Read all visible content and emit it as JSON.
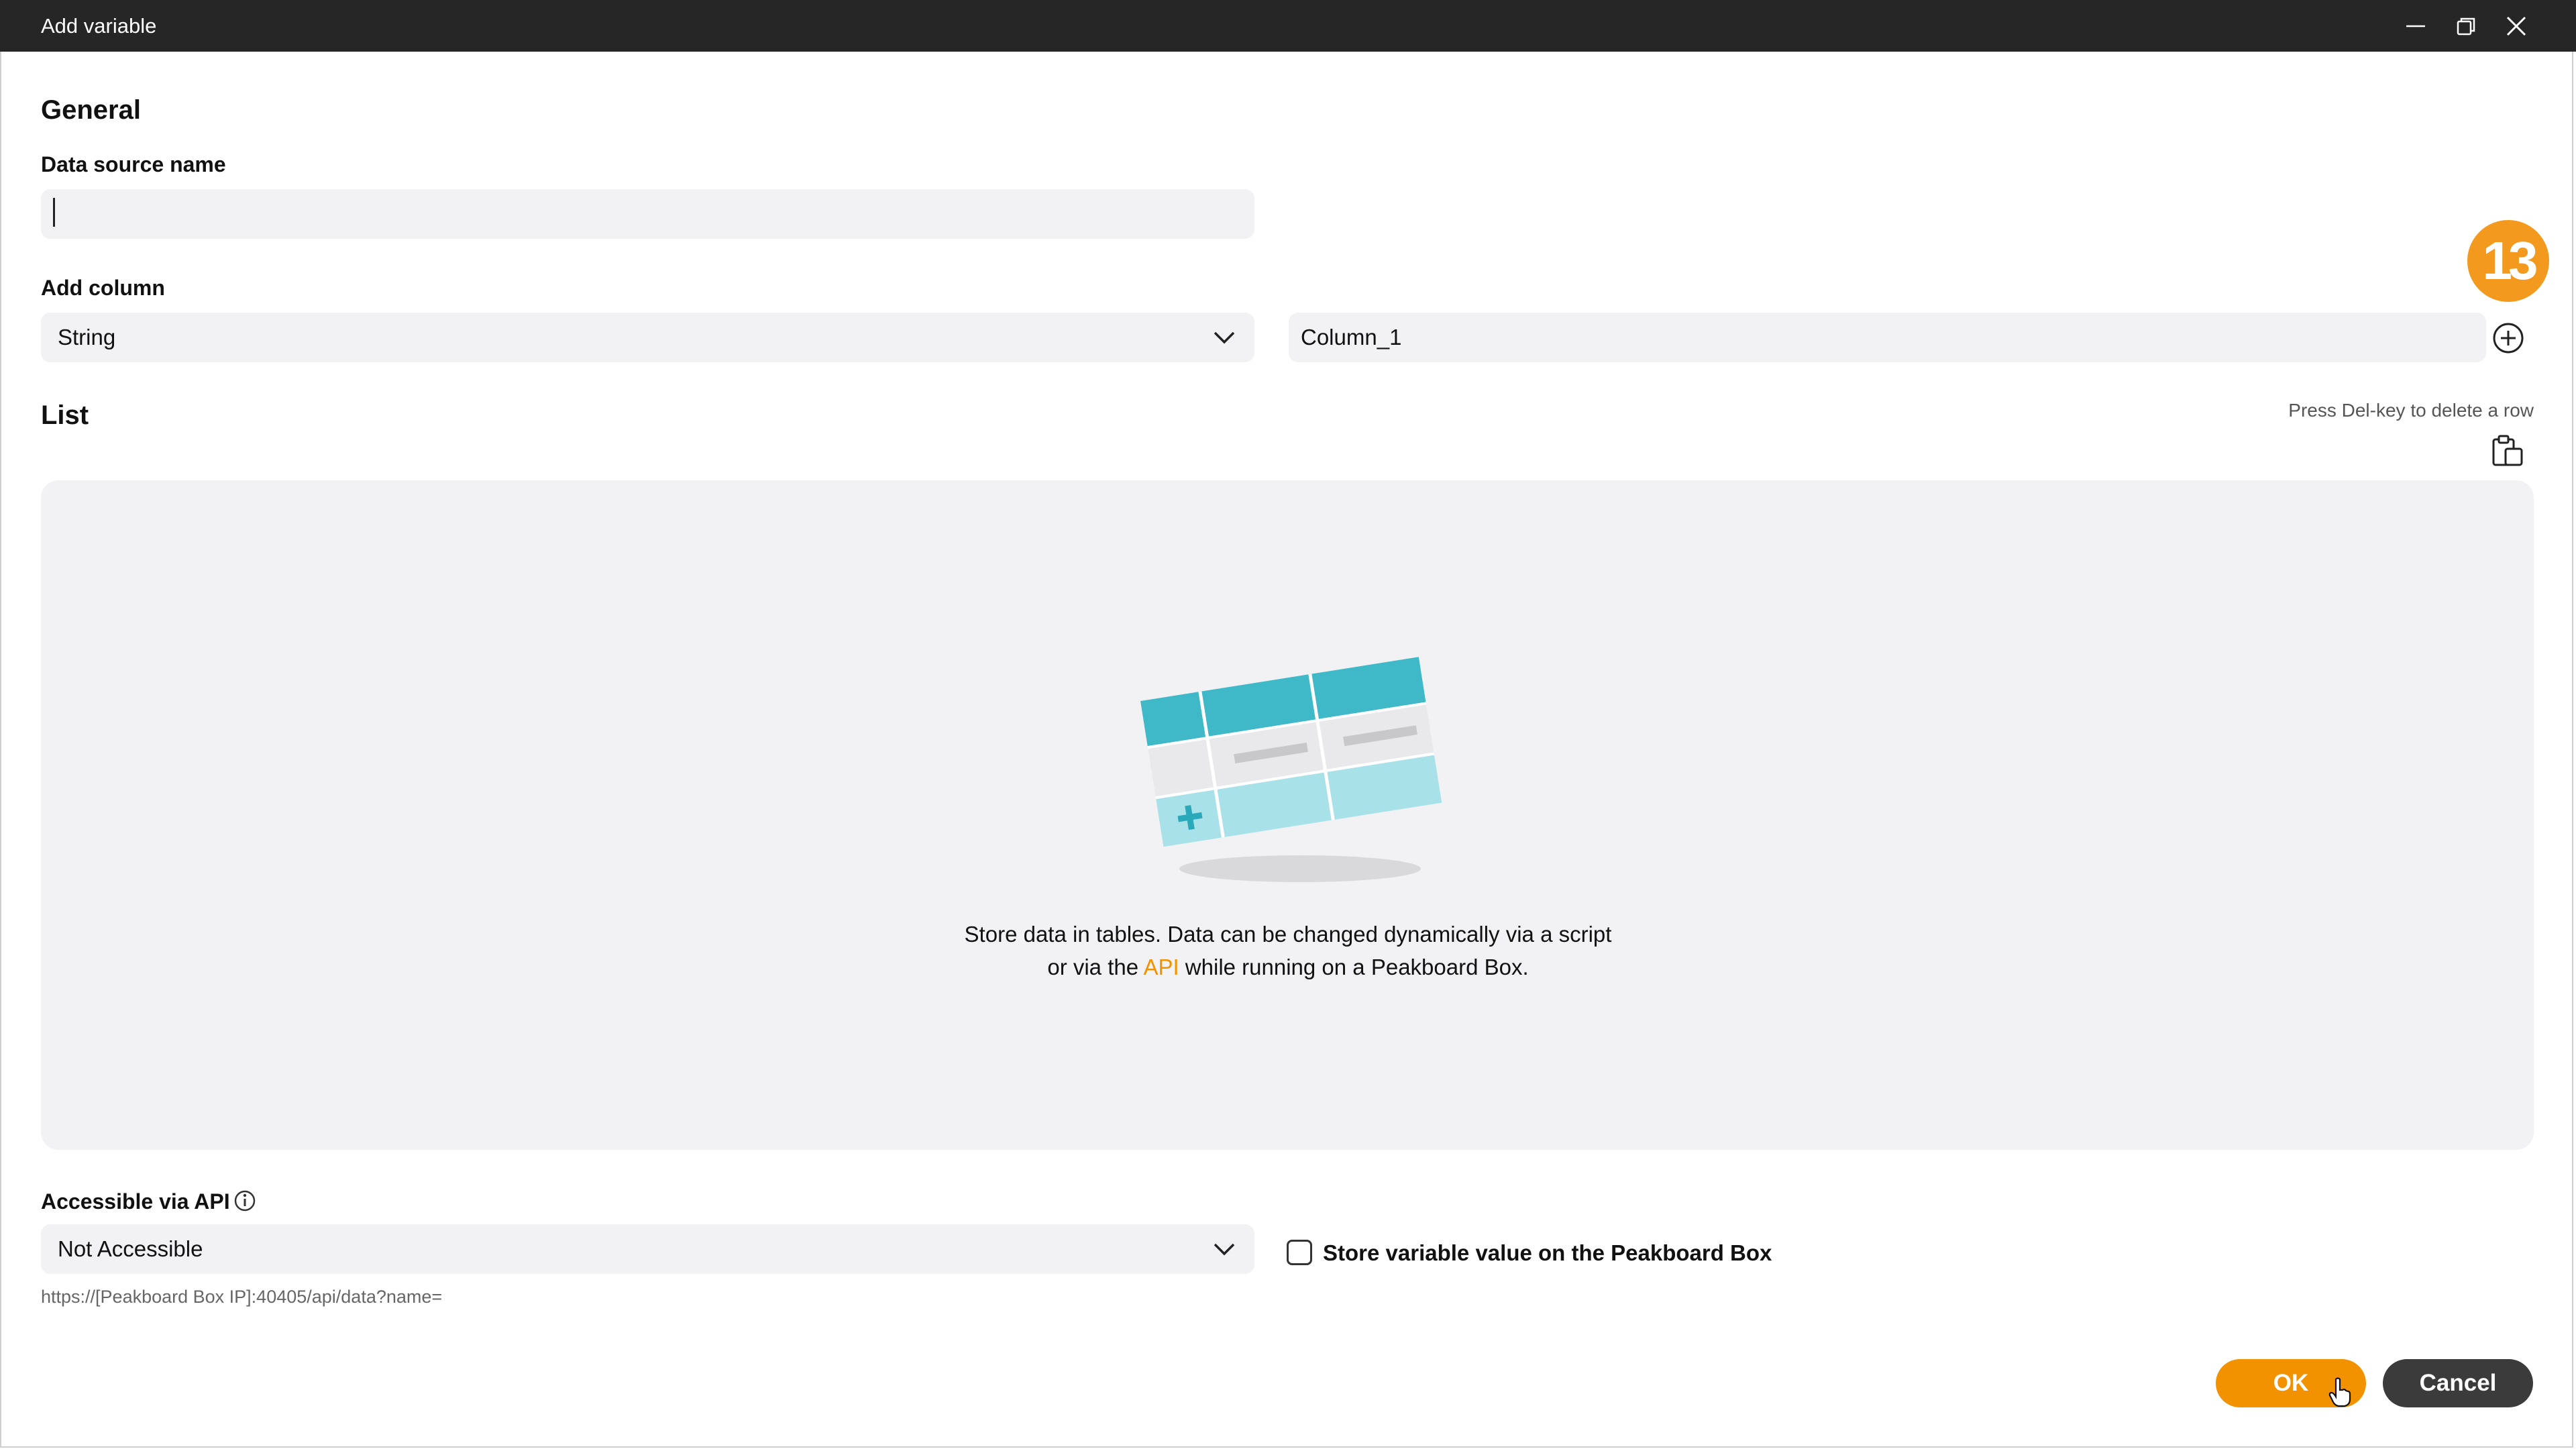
{
  "window": {
    "title": "Add variable"
  },
  "general": {
    "heading": "General",
    "data_source_label": "Data source name",
    "data_source_value": ""
  },
  "add_column": {
    "label": "Add column",
    "type_selected": "String",
    "column_name": "Column_1"
  },
  "list": {
    "heading": "List",
    "delete_hint": "Press Del-key to delete a row",
    "empty_line1": "Store data in tables. Data can be changed dynamically via a script",
    "empty_line2_prefix": "or via the ",
    "empty_line2_link": "API",
    "empty_line2_suffix": " while running on a Peakboard Box."
  },
  "api": {
    "label": "Accessible via API",
    "selected": "Not Accessible",
    "url": "https://[Peakboard Box IP]:40405/api/data?name=",
    "store_checkbox_label": "Store variable value on the Peakboard Box",
    "store_checked": false
  },
  "badge": {
    "number": "13"
  },
  "buttons": {
    "ok": "OK",
    "cancel": "Cancel"
  },
  "colors": {
    "accent": "#f39200",
    "titlebar": "#262626",
    "panel": "#f2f2f5"
  },
  "icons": [
    "minimize-icon",
    "restore-icon",
    "close-icon",
    "chevron-down-icon",
    "add-circle-icon",
    "paste-icon",
    "info-icon",
    "table-illustration",
    "cursor-hand-icon"
  ]
}
